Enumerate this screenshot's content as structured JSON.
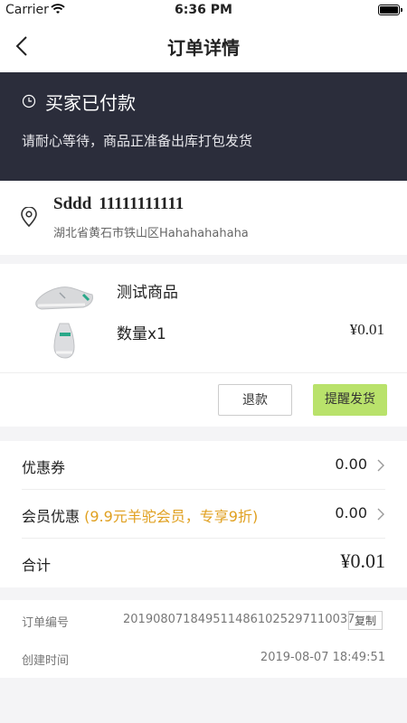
{
  "status_bar": {
    "carrier": "Carrier",
    "time": "6:36 PM"
  },
  "nav": {
    "title": "订单详情",
    "back_icon": "chevron-left-icon"
  },
  "order_status": {
    "title": "买家已付款",
    "description": "请耐心等待，商品正准备出库打包发货"
  },
  "address": {
    "name": "Sddd",
    "phone": "11111111111",
    "detail": "湖北省黄石市铁山区Hahahahahaha"
  },
  "product": {
    "name": "测试商品",
    "quantity": "数量x1",
    "price": "¥0.01"
  },
  "actions": {
    "refund": "退款",
    "remind": "提醒发货"
  },
  "summary": {
    "coupon_label": "优惠券",
    "coupon_value": "0.00",
    "member_label": "会员优惠",
    "member_promo": "(9.9元羊驼会员，专享9折)",
    "member_value": "0.00",
    "total_label": "合计",
    "total_value": "¥0.01"
  },
  "order_info": {
    "number_label": "订单编号",
    "number_value": "2019080718495114861025297110037",
    "copy_label": "复制",
    "created_label": "创建时间",
    "created_value": "2019-08-07 18:49:51"
  },
  "colors": {
    "banner_bg": "#2b2d3b",
    "remind_button": "#b9e26b",
    "promo_text": "#e0a020"
  }
}
